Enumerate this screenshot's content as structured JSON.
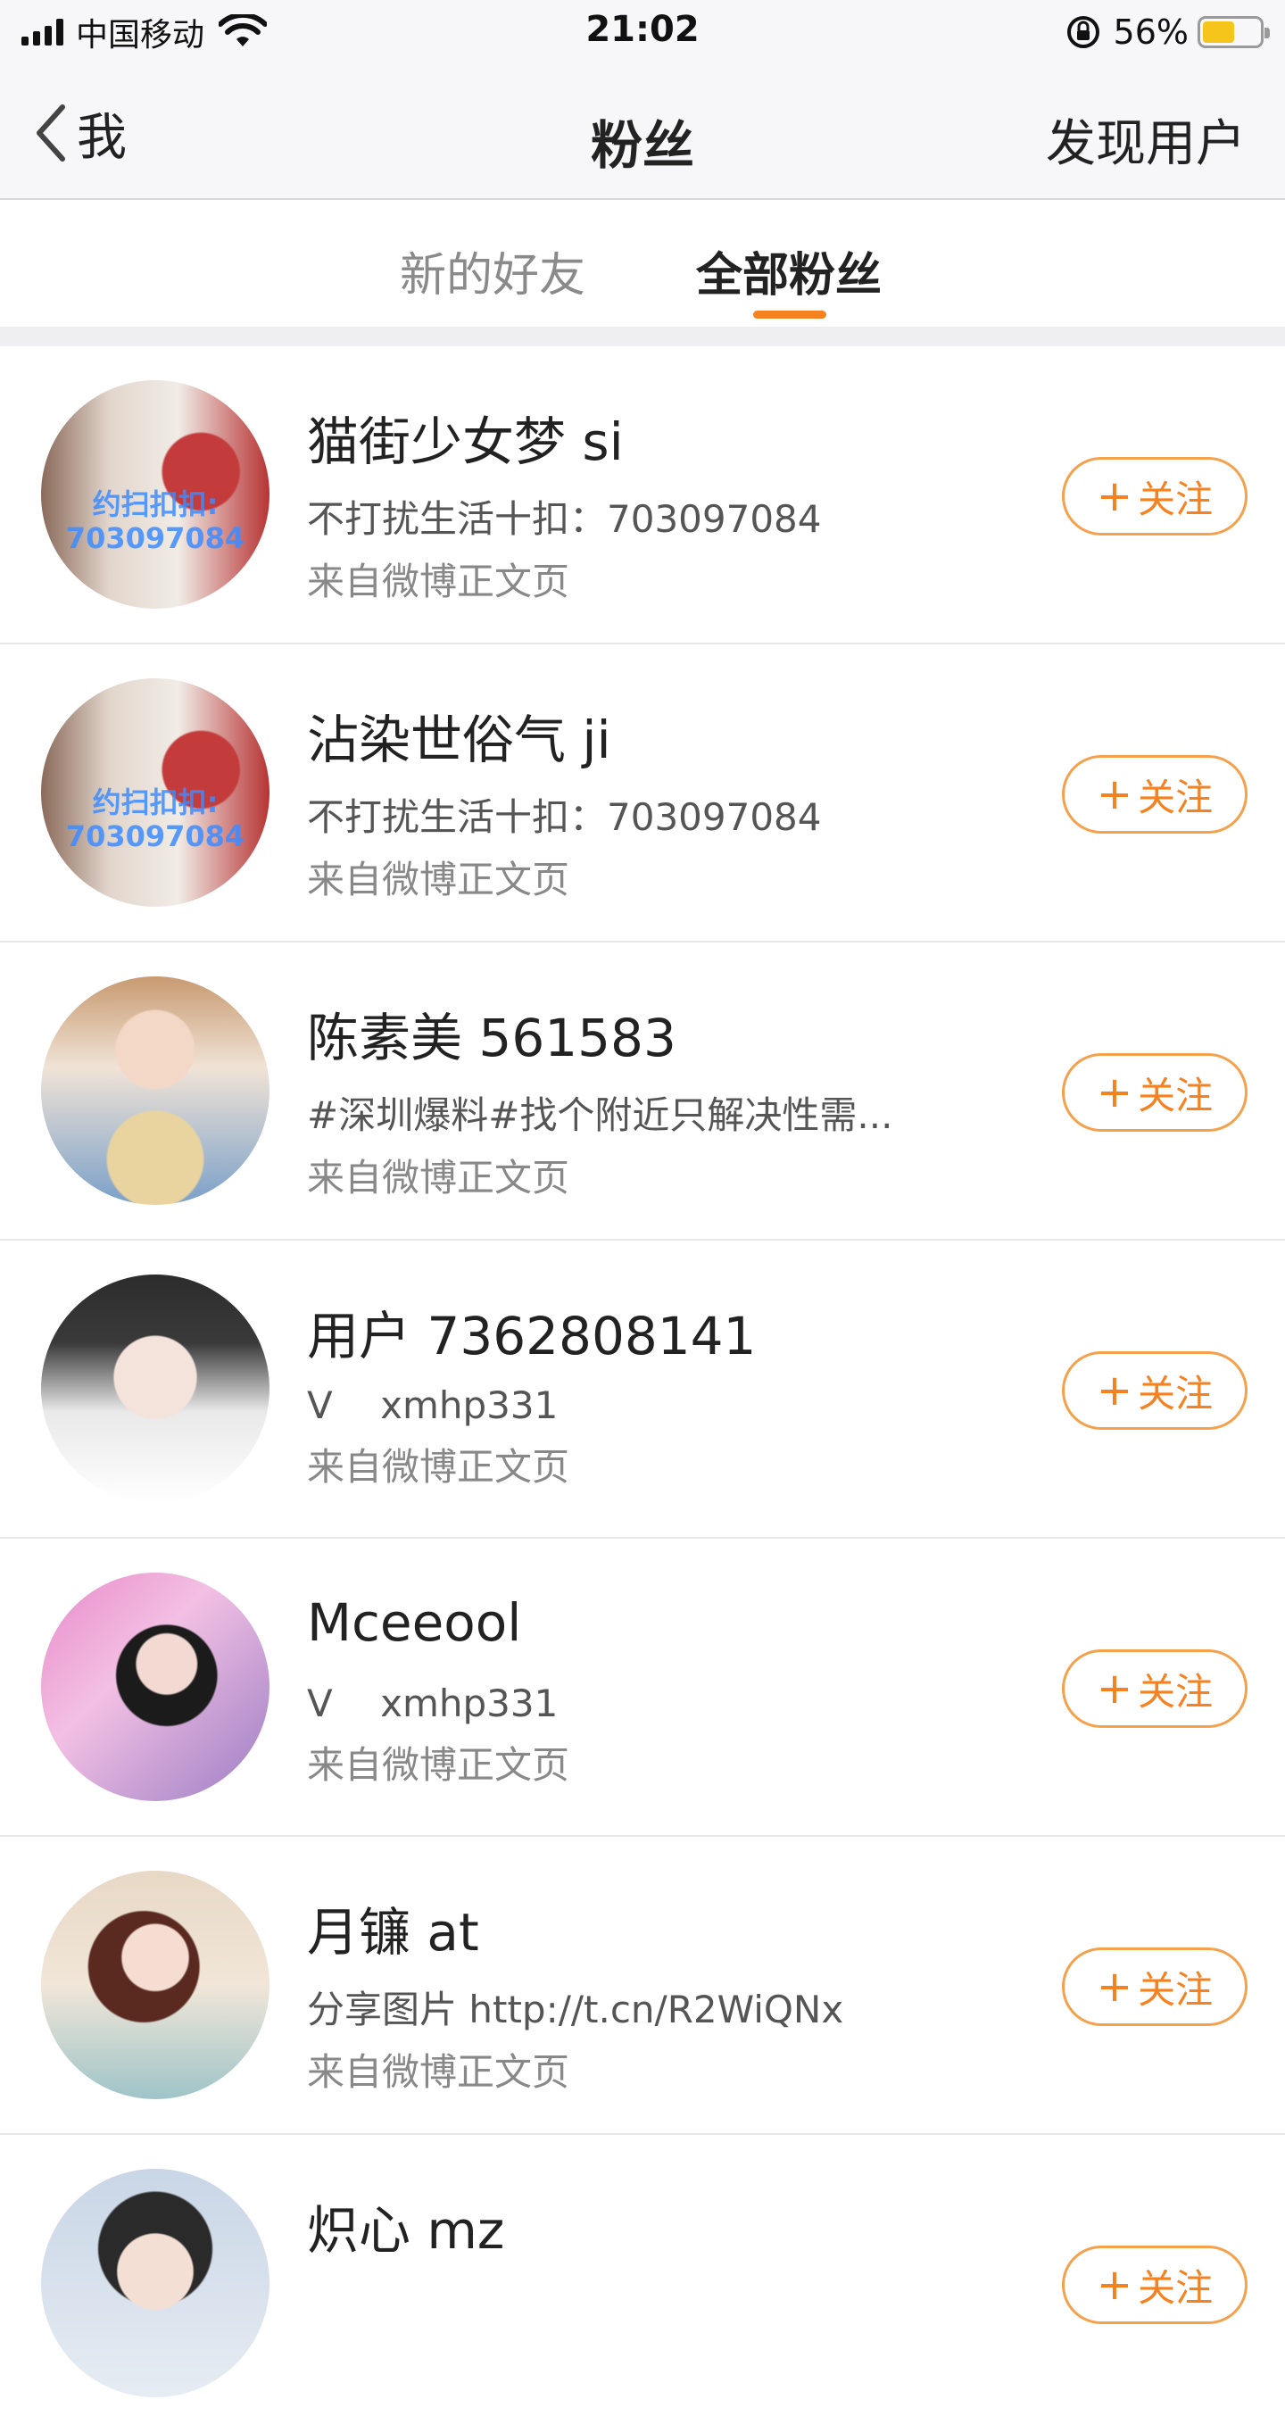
{
  "status_bar": {
    "carrier": "中国移动",
    "time": "21:02",
    "battery_percent": "56%",
    "battery_level": 0.56,
    "battery_color": "#f6c51c"
  },
  "nav": {
    "back_label": "我",
    "title": "粉丝",
    "right_action": "发现用户"
  },
  "tabs": [
    {
      "label": "新的好友",
      "active": false
    },
    {
      "label": "全部粉丝",
      "active": true
    }
  ],
  "accent_color": "#f5811f",
  "follow_label": "关注",
  "fans": [
    {
      "name": "猫街少女梦 si",
      "desc": "不打扰生活十扣：703097084",
      "source": "来自微博正文页",
      "avatar_text": "约扫扣扣:\n703097084"
    },
    {
      "name": "沾染世俗气 ji",
      "desc": "不打扰生活十扣：703097084",
      "source": "来自微博正文页",
      "avatar_text": "约扫扣扣:\n703097084"
    },
    {
      "name": "陈素美 561583",
      "desc": "#深圳爆料#找个附近只解决性需...",
      "source": "来自微博正文页"
    },
    {
      "name": "用户 7362808141",
      "desc": "V    xmhp331",
      "source": "来自微博正文页"
    },
    {
      "name": "Mceeool",
      "desc": "V    xmhp331",
      "source": "来自微博正文页"
    },
    {
      "name": "月镰 at",
      "desc": "分享图片 http://t.cn/R2WiQNx",
      "source": "来自微博正文页"
    },
    {
      "name": "炽心 mz",
      "desc": "",
      "source": ""
    }
  ]
}
